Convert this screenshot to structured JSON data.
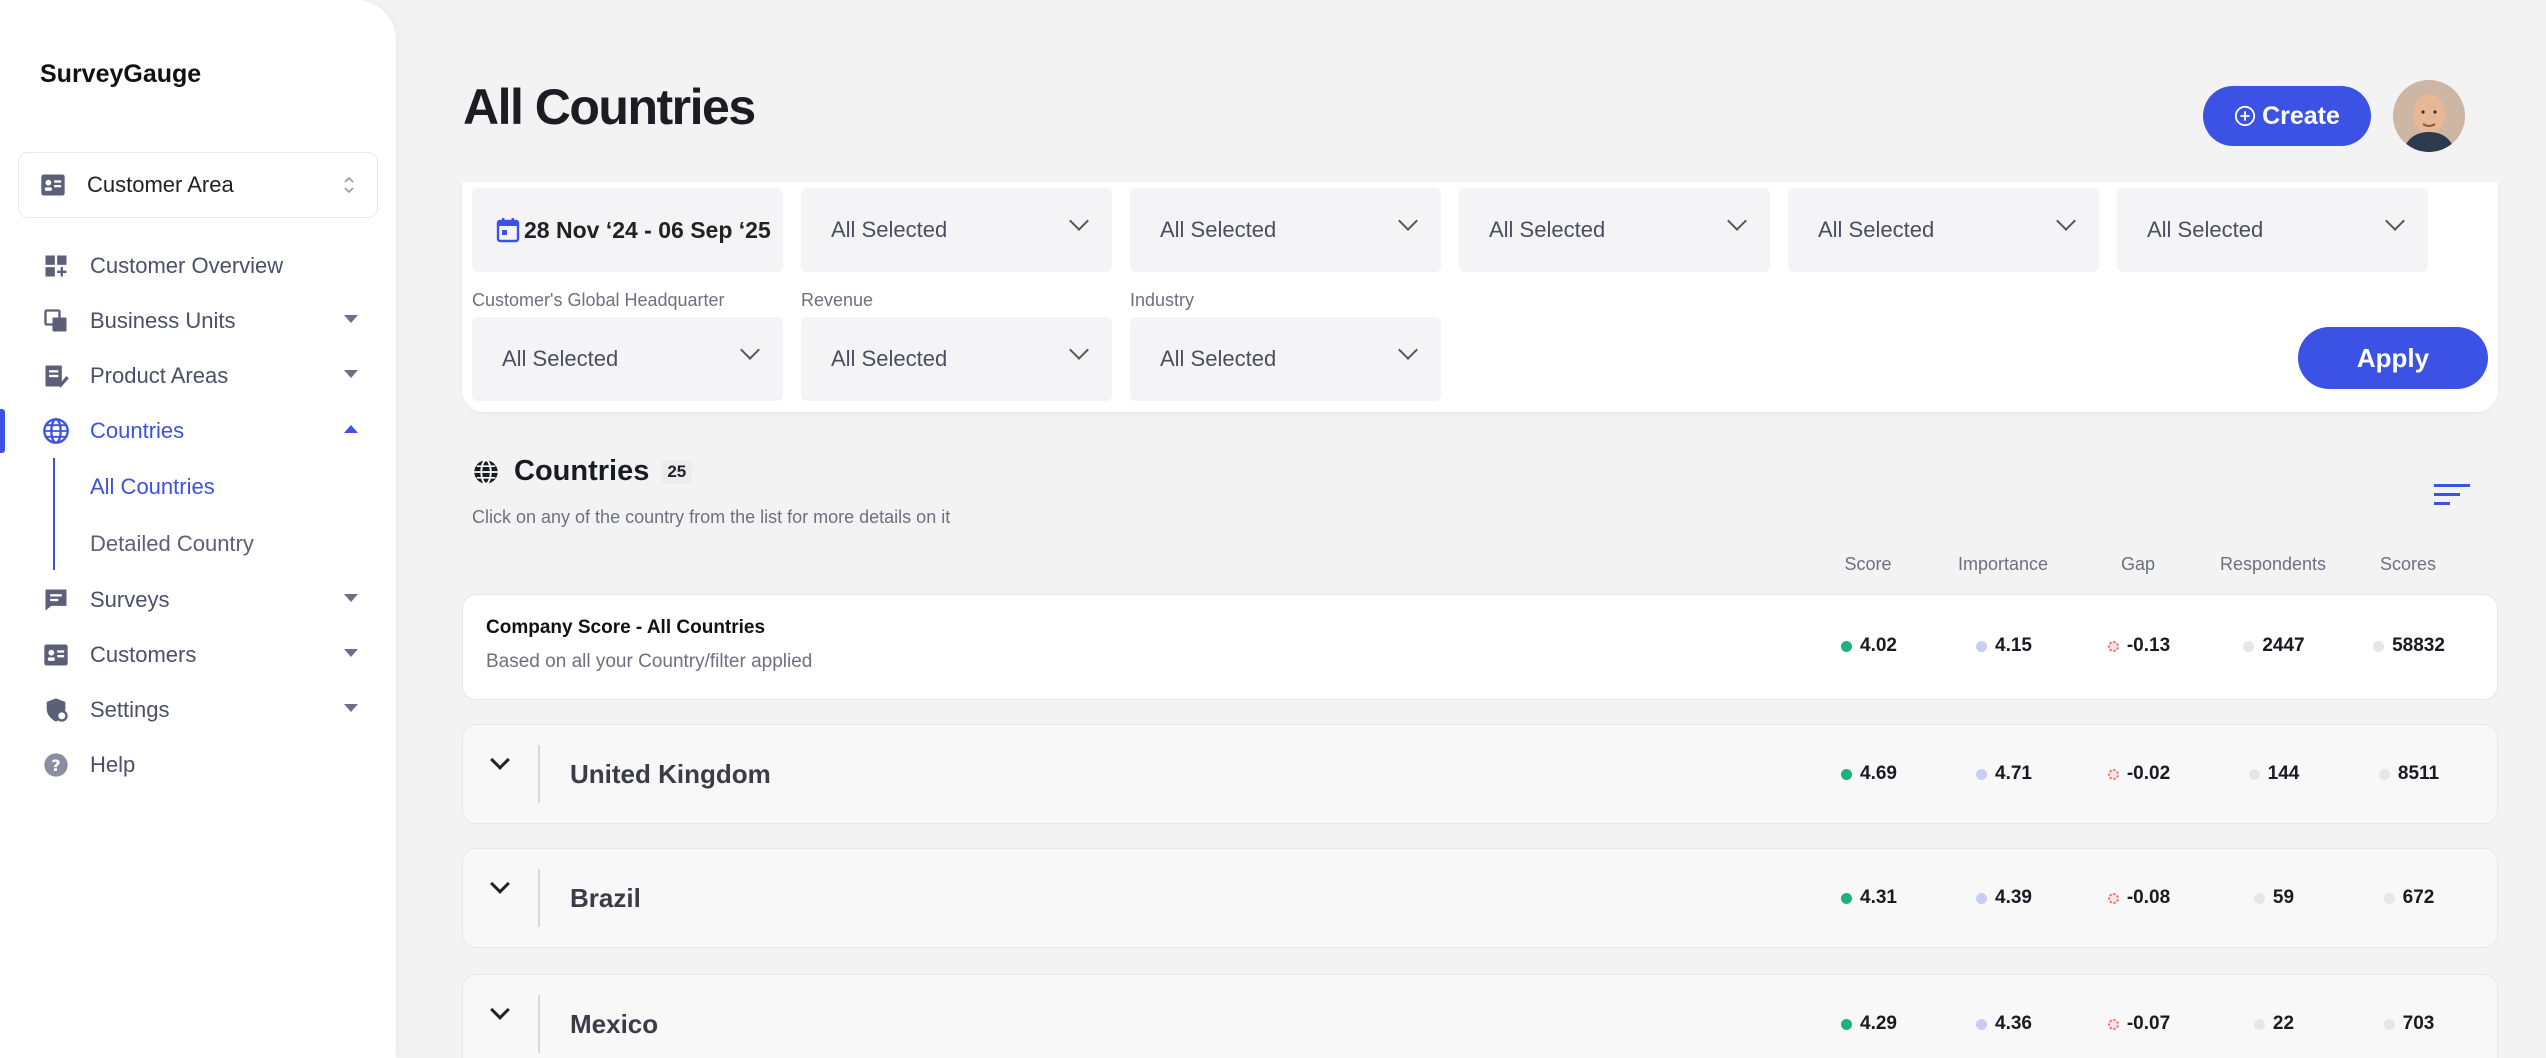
{
  "app": {
    "brand": "SurveyGauge",
    "page_title": "All Countries"
  },
  "sidebar": {
    "area_select": "Customer Area",
    "items": [
      {
        "label": "Customer Overview",
        "icon": "dashboard-icon",
        "has_caret": false
      },
      {
        "label": "Business Units",
        "icon": "copy-icon",
        "has_caret": true
      },
      {
        "label": "Product Areas",
        "icon": "edit-document-icon",
        "has_caret": true
      },
      {
        "label": "Countries",
        "icon": "globe-icon",
        "has_caret": true,
        "active": true
      },
      {
        "label": "Surveys",
        "icon": "chat-icon",
        "has_caret": true
      },
      {
        "label": "Customers",
        "icon": "contact-card-icon",
        "has_caret": true
      },
      {
        "label": "Settings",
        "icon": "shield-gear-icon",
        "has_caret": true
      },
      {
        "label": "Help",
        "icon": "help-icon",
        "has_caret": false
      }
    ],
    "sub_items": [
      {
        "label": "All Countries",
        "active": true
      },
      {
        "label": "Detailed Country",
        "active": false
      }
    ]
  },
  "header": {
    "create_label": "Create"
  },
  "filters": {
    "date_range": "28 Nov ‘24 - 06 Sep ‘25",
    "row1": [
      "All Selected",
      "All Selected",
      "All Selected",
      "All Selected",
      "All Selected"
    ],
    "labels": [
      "Customer's Global Headquarter",
      "Revenue",
      "Industry"
    ],
    "row2": [
      "All Selected",
      "All Selected",
      "All Selected"
    ],
    "apply_label": "Apply"
  },
  "countries": {
    "title": "Countries",
    "count": "25",
    "subtitle": "Click on any of the country from the list for more details on it",
    "columns": [
      "Score",
      "Importance",
      "Gap",
      "Respondents",
      "Scores"
    ],
    "company": {
      "title": "Company Score - All Countries",
      "subtitle": "Based on all your Country/filter applied",
      "values": [
        "4.02",
        "4.15",
        "-0.13",
        "2447",
        "58832"
      ]
    },
    "rows": [
      {
        "name": "United Kingdom",
        "values": [
          "4.69",
          "4.71",
          "-0.02",
          "144",
          "8511"
        ]
      },
      {
        "name": "Brazil",
        "values": [
          "4.31",
          "4.39",
          "-0.08",
          "59",
          "672"
        ]
      },
      {
        "name": "Mexico",
        "values": [
          "4.29",
          "4.36",
          "-0.07",
          "22",
          "703"
        ]
      }
    ]
  },
  "colors": {
    "accent": "#3b52e4",
    "score_dot": "#22b07d",
    "importance_dot": "#c9cdf3",
    "gap_dot": "#e86a6a"
  }
}
